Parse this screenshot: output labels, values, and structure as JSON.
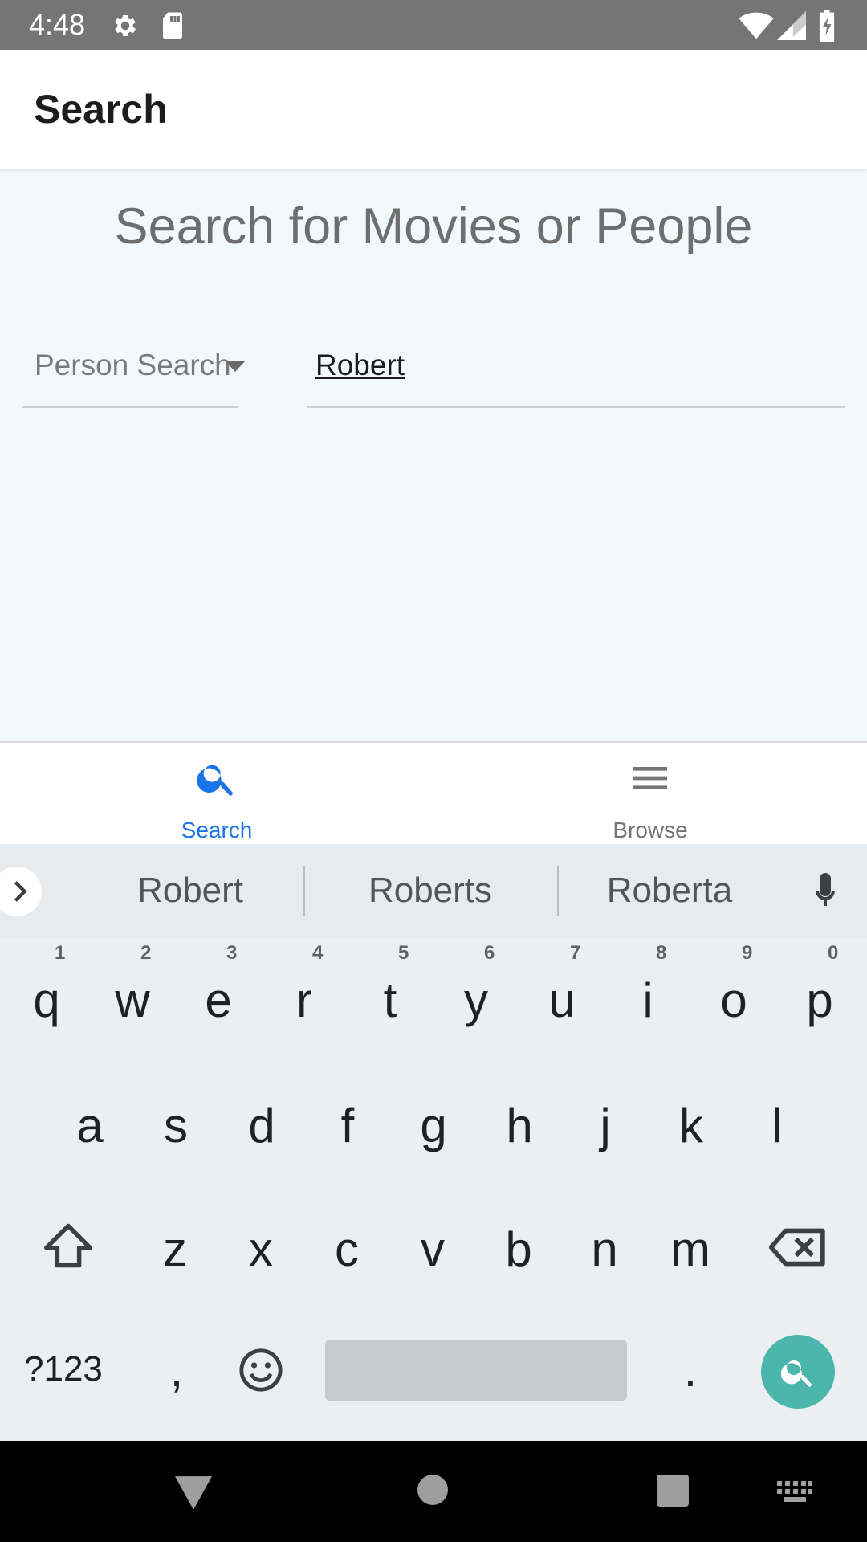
{
  "status_bar": {
    "time": "4:48"
  },
  "app_bar": {
    "title": "Search"
  },
  "content": {
    "heading": "Search for Movies or People",
    "search_type": "Person Search",
    "search_value": "Robert"
  },
  "bottom_nav": [
    {
      "label": "Search",
      "icon": "search-icon",
      "active": true,
      "color": "#1a73e8"
    },
    {
      "label": "Browse",
      "icon": "menu-icon",
      "active": false,
      "color": "#757575"
    }
  ],
  "keyboard": {
    "suggestions": [
      "Robert",
      "Roberts",
      "Roberta"
    ],
    "row1": [
      "q",
      "w",
      "e",
      "r",
      "t",
      "y",
      "u",
      "i",
      "o",
      "p"
    ],
    "row1_hints": [
      "1",
      "2",
      "3",
      "4",
      "5",
      "6",
      "7",
      "8",
      "9",
      "0"
    ],
    "row2": [
      "a",
      "s",
      "d",
      "f",
      "g",
      "h",
      "j",
      "k",
      "l"
    ],
    "row3": [
      "z",
      "x",
      "c",
      "v",
      "b",
      "n",
      "m"
    ],
    "symbols_key": "?123",
    "comma_key": ",",
    "period_key": ".",
    "action_color": "#4db6ac"
  }
}
